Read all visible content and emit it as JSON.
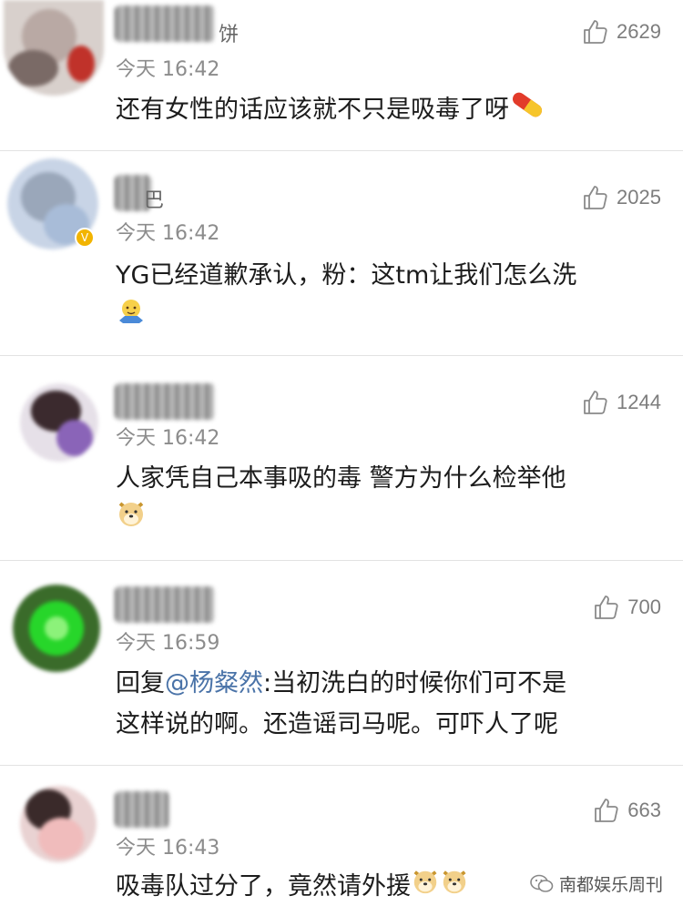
{
  "comments": [
    {
      "name_tail": "饼",
      "time": "今天 16:42",
      "likes": "2629",
      "lines": [
        "还有女性的话应该就不只是吸毒了呀"
      ],
      "emoji": "pill-emoji"
    },
    {
      "name_tail": "巴",
      "time": "今天 16:42",
      "likes": "2025",
      "lines": [
        "YG已经道歉承认，粉：这tm让我们怎么洗"
      ],
      "emoji": "shrug-emoji",
      "verified": true
    },
    {
      "name_tail": "",
      "time": "今天 16:42",
      "likes": "1244",
      "lines": [
        "人家凭自己本事吸的毒 警方为什么检举他"
      ],
      "emoji": "doge-emoji"
    },
    {
      "name_tail": "",
      "time": "今天 16:59",
      "likes": "700",
      "reply_prefix": "回复",
      "mention": "@杨粲然",
      "line1_rest": ":当初洗白的时候你们可不是",
      "line2": "这样说的啊。还造谣司马呢。可吓人了呢"
    },
    {
      "name_tail": "",
      "time": "今天 16:43",
      "likes": "663",
      "lines": [
        "吸毒队过分了，竟然请外援"
      ],
      "emoji": "doge-emoji"
    }
  ],
  "watermark": "南都娱乐周刊",
  "colors": {
    "mention": "#4a73a8",
    "time": "#8c8c8c",
    "divider": "#e2e2e2"
  },
  "icons": {
    "like": "thumbs-up-icon",
    "watermark": "wechat-icon"
  }
}
